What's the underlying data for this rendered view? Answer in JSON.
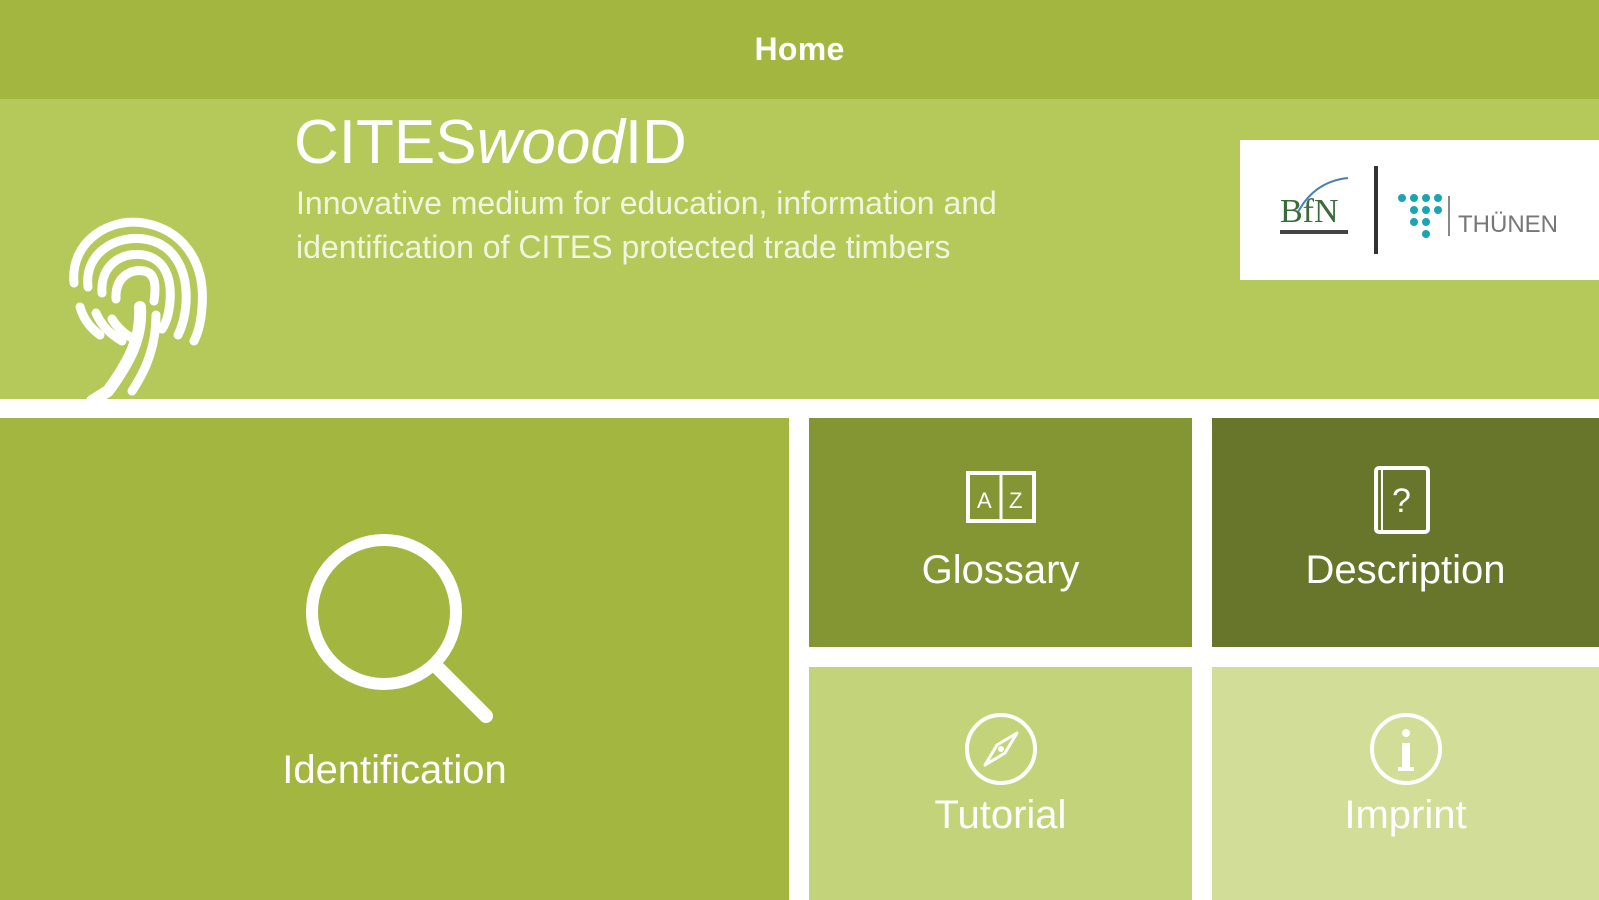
{
  "navbar": {
    "title": "Home"
  },
  "header": {
    "app_title_prefix": "CITES",
    "app_title_italic": "wood",
    "app_title_suffix": "ID",
    "subtitle": "Innovative medium for education, information and identification of CITES protected trade timbers",
    "logo_bfn_text": "BfN",
    "logo_thuenen_text": "THÜNEN"
  },
  "tiles": {
    "identification": {
      "label": "Identification",
      "icon": "search-icon"
    },
    "glossary": {
      "label": "Glossary",
      "icon": "az-book-icon"
    },
    "description": {
      "label": "Description",
      "icon": "question-book-icon"
    },
    "tutorial": {
      "label": "Tutorial",
      "icon": "compass-icon"
    },
    "imprint": {
      "label": "Imprint",
      "icon": "info-icon"
    }
  },
  "colors": {
    "navbar": "#a3b63f",
    "header": "#b5c85a",
    "identification": "#a3b63f",
    "glossary": "#849534",
    "description": "#67762a",
    "tutorial": "#c3d37a",
    "imprint": "#d2dd97"
  }
}
